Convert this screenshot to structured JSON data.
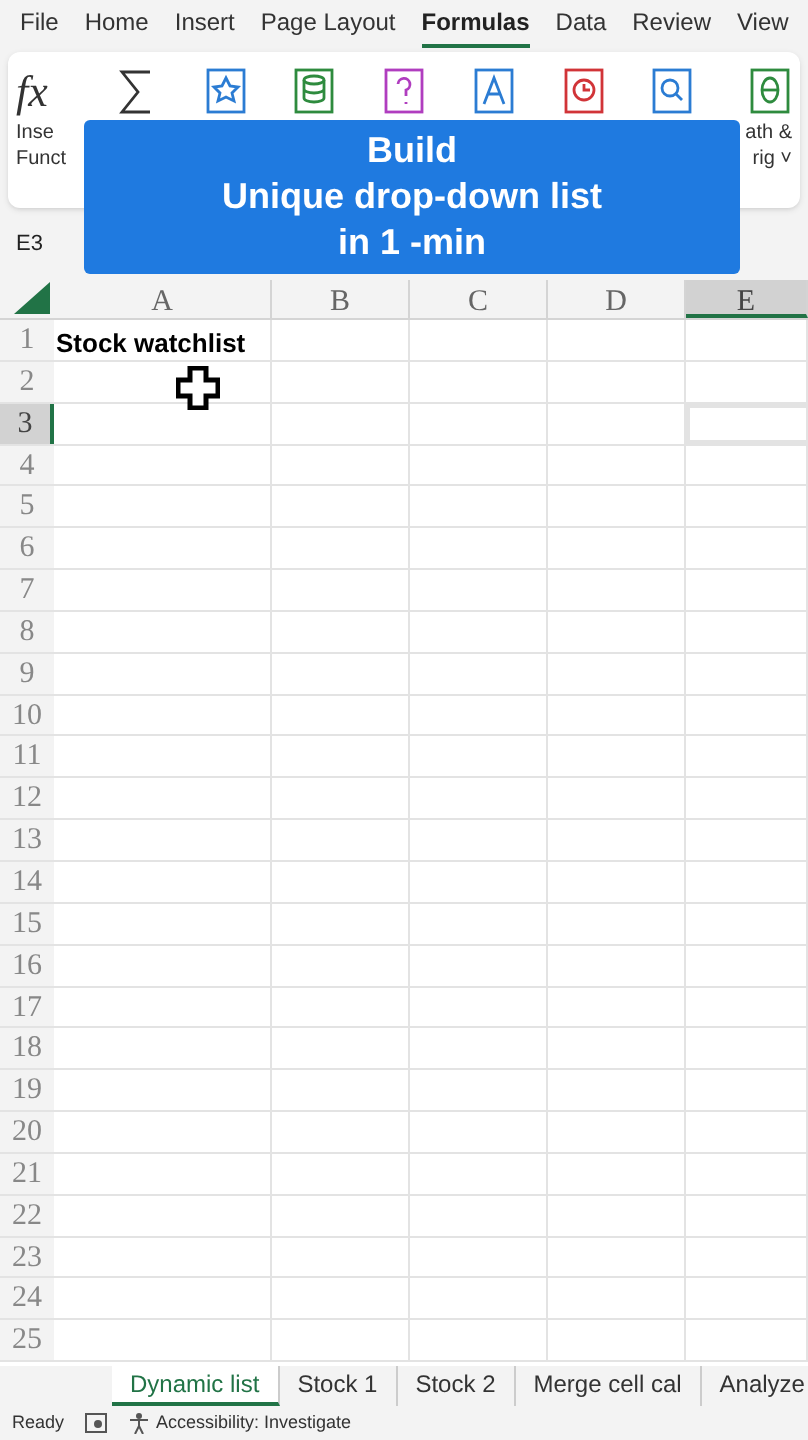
{
  "menu": [
    {
      "label": "File",
      "selected": false
    },
    {
      "label": "Home",
      "selected": false
    },
    {
      "label": "Insert",
      "selected": false
    },
    {
      "label": "Page Layout",
      "selected": false
    },
    {
      "label": "Formulas",
      "selected": true
    },
    {
      "label": "Data",
      "selected": false
    },
    {
      "label": "Review",
      "selected": false
    },
    {
      "label": "View",
      "selected": false
    }
  ],
  "ribbon": [
    {
      "kind": "fx",
      "symbol": "fx",
      "lines": [
        "Inse",
        "Funct"
      ]
    },
    {
      "kind": "sum"
    },
    {
      "kind": "star"
    },
    {
      "kind": "db"
    },
    {
      "kind": "question"
    },
    {
      "kind": "text"
    },
    {
      "kind": "clock"
    },
    {
      "kind": "search"
    },
    {
      "kind": "theta",
      "lines": [
        "ath &",
        "rig ˅"
      ]
    }
  ],
  "banner": {
    "lines": [
      "Build",
      "Unique drop-down list",
      "in 1 -min"
    ]
  },
  "name_box": "E3",
  "columns": [
    {
      "label": "A",
      "selected": false
    },
    {
      "label": "B",
      "selected": false
    },
    {
      "label": "C",
      "selected": false
    },
    {
      "label": "D",
      "selected": false
    },
    {
      "label": "E",
      "selected": true
    }
  ],
  "rows": [
    {
      "number": "1",
      "selected": false,
      "a": "Stock watchlist"
    },
    {
      "number": "2",
      "selected": false
    },
    {
      "number": "3",
      "selected": true
    },
    {
      "number": "4",
      "selected": false
    },
    {
      "number": "5",
      "selected": false
    },
    {
      "number": "6",
      "selected": false
    },
    {
      "number": "7",
      "selected": false
    },
    {
      "number": "8",
      "selected": false
    },
    {
      "number": "9",
      "selected": false
    },
    {
      "number": "10",
      "selected": false
    },
    {
      "number": "11",
      "selected": false
    },
    {
      "number": "12",
      "selected": false
    },
    {
      "number": "13",
      "selected": false
    },
    {
      "number": "14",
      "selected": false
    },
    {
      "number": "15",
      "selected": false
    },
    {
      "number": "16",
      "selected": false
    },
    {
      "number": "17",
      "selected": false
    },
    {
      "number": "18",
      "selected": false
    },
    {
      "number": "19",
      "selected": false
    },
    {
      "number": "20",
      "selected": false
    },
    {
      "number": "21",
      "selected": false
    },
    {
      "number": "22",
      "selected": false
    },
    {
      "number": "23",
      "selected": false
    },
    {
      "number": "24",
      "selected": false
    },
    {
      "number": "25",
      "selected": false
    }
  ],
  "sheet_tabs": [
    {
      "label": "Dynamic list",
      "selected": true
    },
    {
      "label": "Stock 1",
      "selected": false
    },
    {
      "label": "Stock 2",
      "selected": false
    },
    {
      "label": "Merge cell cal",
      "selected": false
    },
    {
      "label": "Analyze",
      "selected": false
    }
  ],
  "status": {
    "ready": "Ready",
    "accessibility": "Accessibility: Investigate"
  }
}
